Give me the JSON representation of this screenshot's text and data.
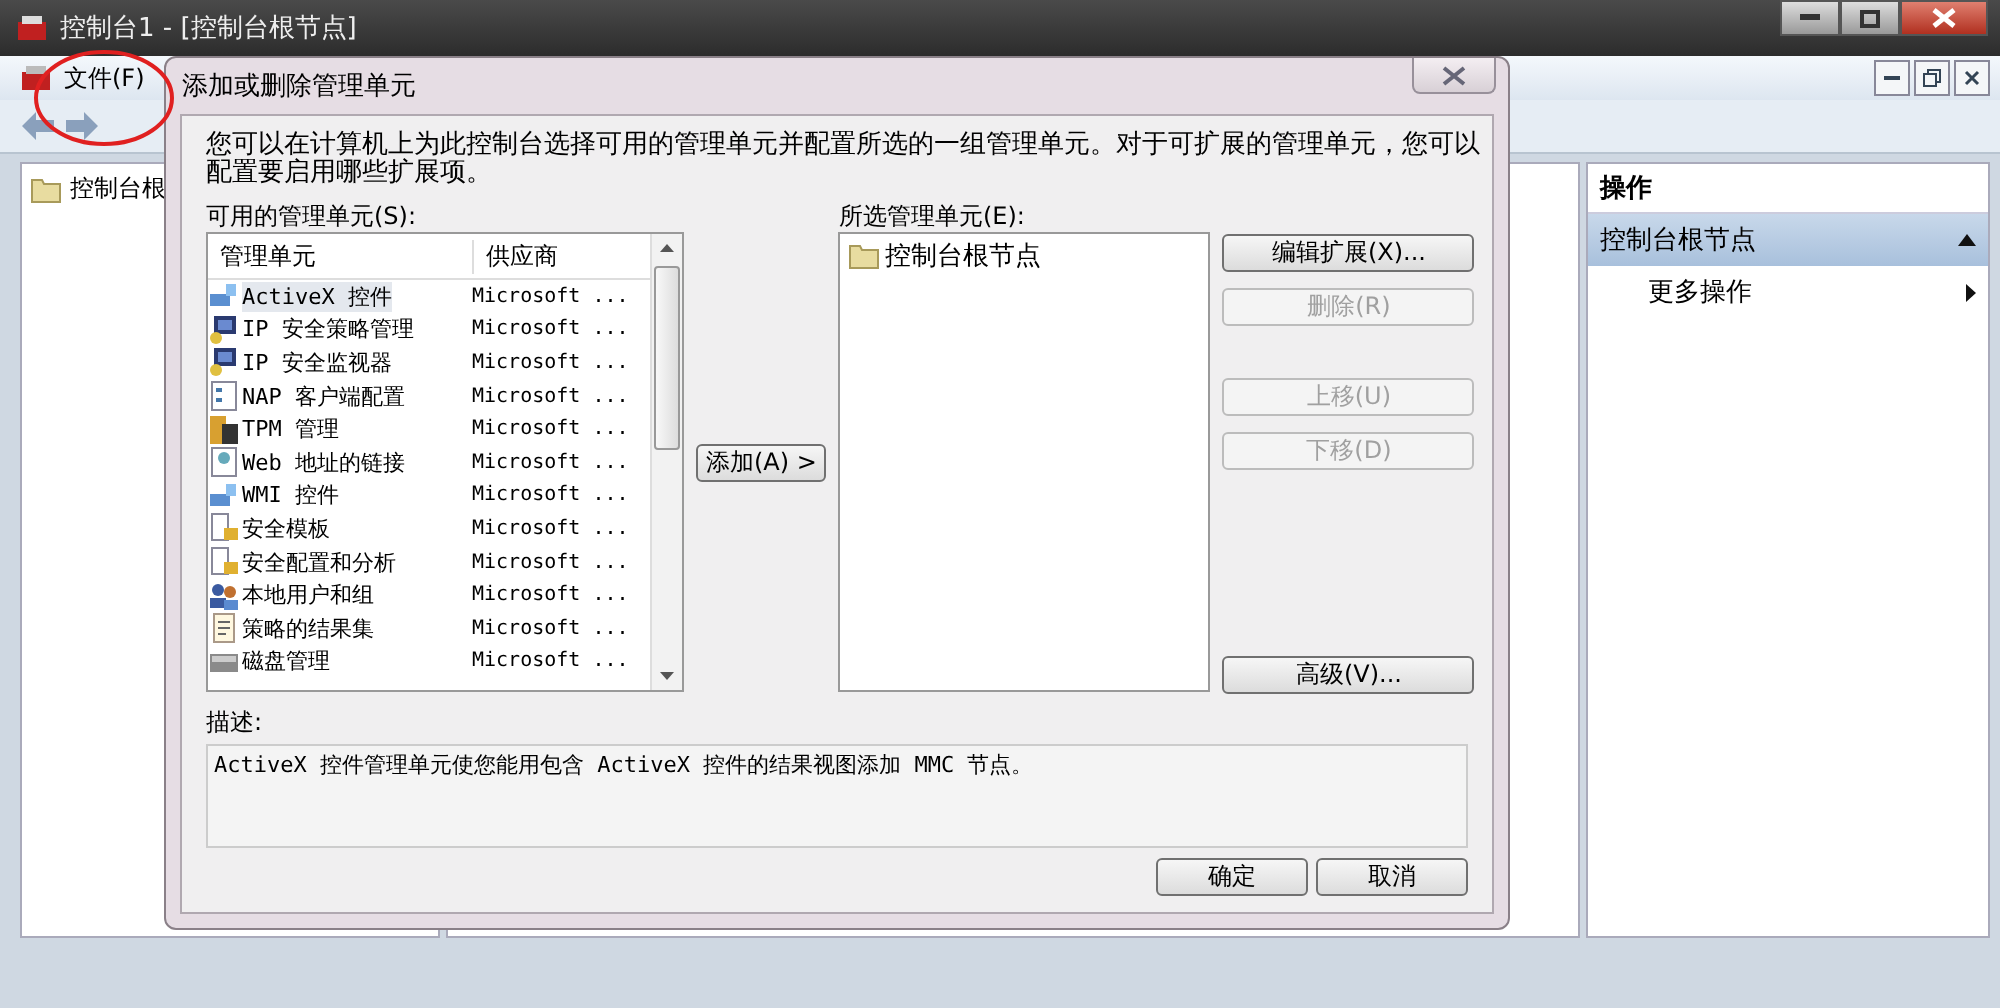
{
  "window": {
    "title": "控制台1 - [控制台根节点]"
  },
  "menu": [
    {
      "label": "文件(F)"
    }
  ],
  "tree": {
    "items": [
      {
        "label": "控制台根"
      }
    ]
  },
  "actions": {
    "title": "操作",
    "section": "控制台根节点",
    "items": [
      {
        "label": "更多操作"
      }
    ]
  },
  "dialog": {
    "title": "添加或删除管理单元",
    "intro": "您可以在计算机上为此控制台选择可用的管理单元并配置所选的一组管理单元。对于可扩展的管理单元，您可以配置要启用哪些扩展项。",
    "available": {
      "label": "可用的管理单元(S):",
      "columns": [
        "管理单元",
        "供应商"
      ],
      "rows": [
        {
          "name": "ActiveX 控件",
          "vendor": "Microsoft ...",
          "kind": "activex",
          "selected": true
        },
        {
          "name": "IP 安全策略管理",
          "vendor": "Microsoft ...",
          "kind": "computer",
          "selected": false
        },
        {
          "name": "IP 安全监视器",
          "vendor": "Microsoft ...",
          "kind": "computer",
          "selected": false
        },
        {
          "name": "NAP 客户端配置",
          "vendor": "Microsoft ...",
          "kind": "form",
          "selected": false
        },
        {
          "name": "TPM 管理",
          "vendor": "Microsoft ...",
          "kind": "chip",
          "selected": false
        },
        {
          "name": "Web 地址的链接",
          "vendor": "Microsoft ...",
          "kind": "web",
          "selected": false
        },
        {
          "name": "WMI 控件",
          "vendor": "Microsoft ...",
          "kind": "activex",
          "selected": false
        },
        {
          "name": "安全模板",
          "vendor": "Microsoft ...",
          "kind": "lock",
          "selected": false
        },
        {
          "name": "安全配置和分析",
          "vendor": "Microsoft ...",
          "kind": "lock",
          "selected": false
        },
        {
          "name": "本地用户和组",
          "vendor": "Microsoft ...",
          "kind": "users",
          "selected": false
        },
        {
          "name": "策略的结果集",
          "vendor": "Microsoft ...",
          "kind": "doc",
          "selected": false
        },
        {
          "name": "磁盘管理",
          "vendor": "Microsoft ...",
          "kind": "disk",
          "selected": false
        }
      ]
    },
    "add_button": "添加(A) >",
    "selected_list": {
      "label": "所选管理单元(E):",
      "items": [
        {
          "label": "控制台根节点"
        }
      ]
    },
    "side_buttons": [
      {
        "label": "编辑扩展(X)...",
        "disabled": false
      },
      {
        "label": "删除(R)",
        "disabled": true
      },
      {
        "label": "上移(U)",
        "disabled": true
      },
      {
        "label": "下移(D)",
        "disabled": true
      },
      {
        "label": "高级(V)...",
        "disabled": false
      }
    ],
    "description": {
      "label": "描述:",
      "text": "ActiveX 控件管理单元使您能用包含 ActiveX 控件的结果视图添加 MMC 节点。"
    },
    "buttons": [
      "确定",
      "取消"
    ]
  }
}
